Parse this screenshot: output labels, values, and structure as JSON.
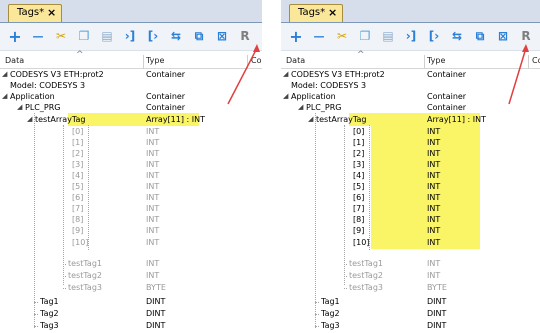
{
  "tab": {
    "label": "Tags*",
    "close": "×"
  },
  "toolbar": [
    {
      "name": "add-icon",
      "glyph": "+",
      "color": "#2a7fd6"
    },
    {
      "name": "remove-icon",
      "glyph": "—",
      "color": "#2a7fd6"
    },
    {
      "name": "cut-icon",
      "glyph": "✂",
      "color": "#d8a000"
    },
    {
      "name": "copy-icon",
      "glyph": "❐",
      "color": "#5aa0d8"
    },
    {
      "name": "paste-icon",
      "glyph": "▤",
      "color": "#8aa8c8"
    },
    {
      "name": "import-icon",
      "glyph": "›]",
      "color": "#2a7fd6"
    },
    {
      "name": "export-icon",
      "glyph": "[›",
      "color": "#2a7fd6"
    },
    {
      "name": "convert-icon",
      "glyph": "⇆",
      "color": "#2a7fd6"
    },
    {
      "name": "dictionary-icon",
      "glyph": "⧉",
      "color": "#2a7fd6"
    },
    {
      "name": "filter-icon",
      "glyph": "⊠",
      "color": "#2a7fd6"
    },
    {
      "name": "r-icon",
      "glyph": "R",
      "color": "#7f7f7f"
    }
  ],
  "columns": {
    "data": "Data",
    "type": "Type",
    "con": "Con"
  },
  "rows": [
    {
      "name": "CODESYS V3 ETH:prot2",
      "type": "Container",
      "level": 0,
      "tri": "◢",
      "dim": false
    },
    {
      "name": "Model: CODESYS 3",
      "type": "",
      "level": 0,
      "tri": "",
      "dim": false
    },
    {
      "name": "Application",
      "type": "Container",
      "level": 1,
      "tri": "◢",
      "dim": false
    },
    {
      "name": "PLC_PRG",
      "type": "Container",
      "level": 2,
      "tri": "◢",
      "dim": false
    },
    {
      "name": "testArrayTag",
      "type": "Array[11] : INT",
      "level": 3,
      "tri": "◢",
      "dim": false
    },
    {
      "name": "[0]",
      "type": "INT",
      "level": 4,
      "tri": "",
      "dim": true
    },
    {
      "name": "[1]",
      "type": "INT",
      "level": 4,
      "tri": "",
      "dim": true
    },
    {
      "name": "[2]",
      "type": "INT",
      "level": 4,
      "tri": "",
      "dim": true
    },
    {
      "name": "[3]",
      "type": "INT",
      "level": 4,
      "tri": "",
      "dim": true
    },
    {
      "name": "[4]",
      "type": "INT",
      "level": 4,
      "tri": "",
      "dim": true
    },
    {
      "name": "[5]",
      "type": "INT",
      "level": 4,
      "tri": "",
      "dim": true
    },
    {
      "name": "[6]",
      "type": "INT",
      "level": 4,
      "tri": "",
      "dim": true
    },
    {
      "name": "[7]",
      "type": "INT",
      "level": 4,
      "tri": "",
      "dim": true
    },
    {
      "name": "[8]",
      "type": "INT",
      "level": 4,
      "tri": "",
      "dim": true
    },
    {
      "name": "[9]",
      "type": "INT",
      "level": 4,
      "tri": "",
      "dim": true
    },
    {
      "name": "[10]",
      "type": "INT",
      "level": 4,
      "tri": "",
      "dim": true
    },
    {
      "name": "testTag1",
      "type": "INT",
      "level": 3,
      "tri": "",
      "dim": true
    },
    {
      "name": "testTag2",
      "type": "INT",
      "level": 3,
      "tri": "",
      "dim": true
    },
    {
      "name": "testTag3",
      "type": "BYTE",
      "level": 3,
      "tri": "",
      "dim": true
    },
    {
      "name": "Tag1",
      "type": "DINT",
      "level": 1,
      "tri": "",
      "dim": false
    },
    {
      "name": "Tag2",
      "type": "DINT",
      "level": 1,
      "tri": "",
      "dim": false
    },
    {
      "name": "Tag3",
      "type": "DINT",
      "level": 1,
      "tri": "",
      "dim": false
    }
  ],
  "colors": {
    "highlight": "#faf567",
    "arrow": "#e04040",
    "tab_active": "#fbe79a"
  }
}
